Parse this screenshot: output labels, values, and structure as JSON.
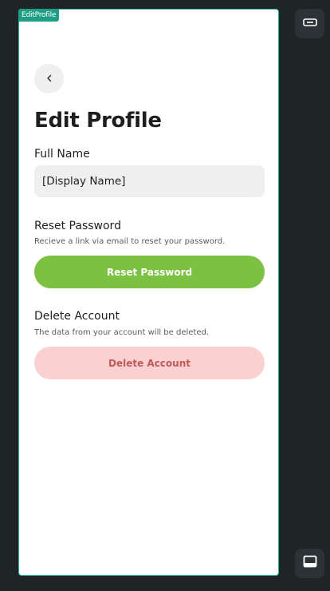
{
  "frame": {
    "tag": "EditProfile"
  },
  "header": {
    "back_icon": "chevron-left-icon",
    "title": "Edit Profile"
  },
  "full_name": {
    "label": "Full Name",
    "value": "[Display Name]"
  },
  "reset_password": {
    "heading": "Reset Password",
    "description": "Recieve a link via email to reset your password.",
    "button_label": "Reset Password",
    "button_color": "#7dc142"
  },
  "delete_account": {
    "heading": "Delete Account",
    "description": "The data from your account will be deleted.",
    "button_label": "Delete Account",
    "button_color": "#fbd0d0",
    "text_color": "#c05a5a"
  },
  "toolbar": {
    "top_icon": "keyboard-icon",
    "bottom_icon": "panel-bottom-icon"
  },
  "colors": {
    "accent": "#2bb59a",
    "background": "#1f2426"
  }
}
